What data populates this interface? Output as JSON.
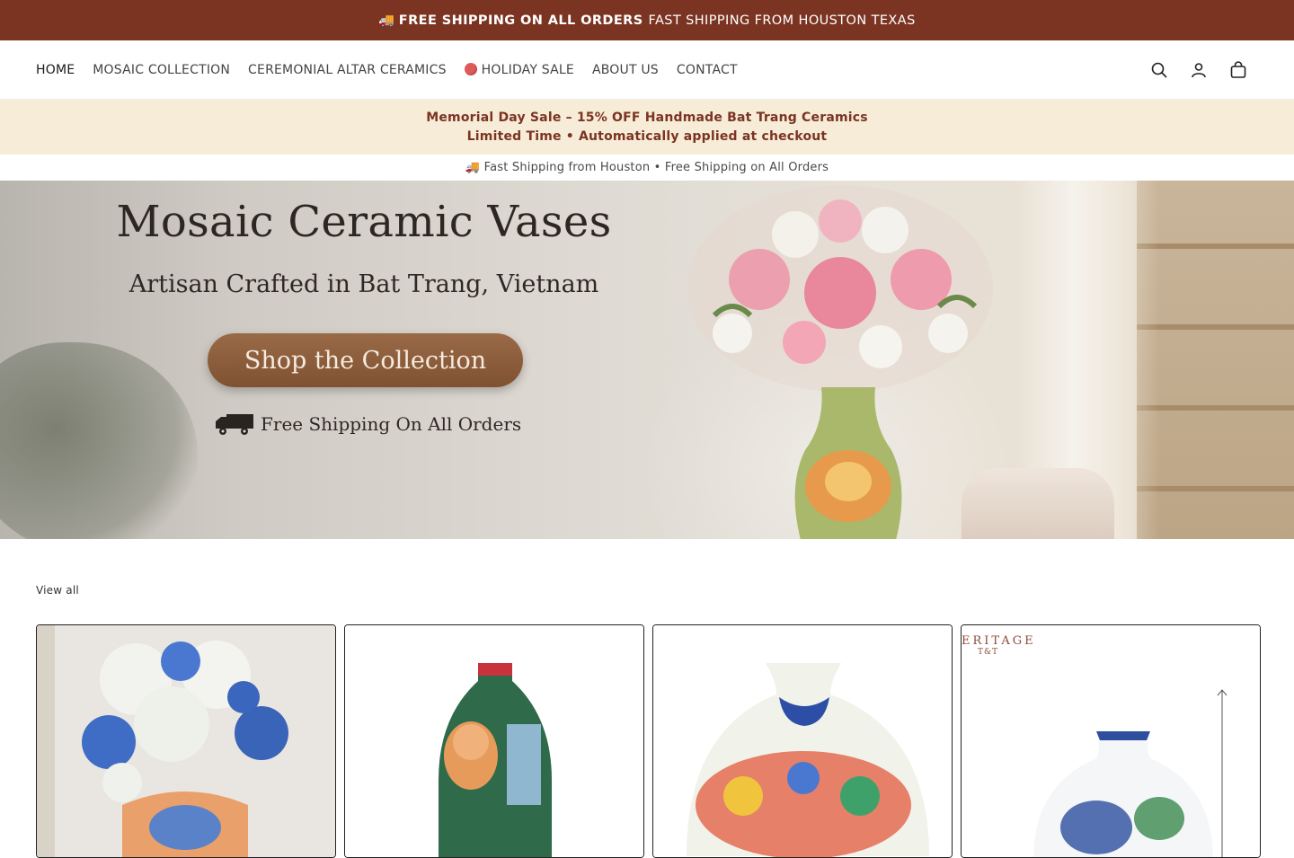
{
  "announcement": {
    "truck": "🚚",
    "bold": "FREE SHIPPING ON ALL ORDERS",
    "text": "FAST SHIPPING FROM HOUSTON TEXAS"
  },
  "nav": {
    "items": [
      {
        "label": "HOME",
        "active": true
      },
      {
        "label": "MOSAIC COLLECTION"
      },
      {
        "label": "CEREMONIAL ALTAR CERAMICS"
      },
      {
        "label": "HOLIDAY SALE",
        "icon": "red-circle-icon"
      },
      {
        "label": "ABOUT US"
      },
      {
        "label": "CONTACT"
      }
    ],
    "icons": [
      "search-icon",
      "account-icon",
      "cart-icon"
    ]
  },
  "sale_banner": {
    "line1": "Memorial Day Sale – 15% OFF Handmade Bat Trang Ceramics",
    "line2": "Limited Time • Automatically applied at checkout"
  },
  "shipping_bar": "🚚 Fast Shipping from Houston • Free Shipping on All Orders",
  "hero": {
    "title": "Mosaic Ceramic Vases",
    "subtitle": "Artisan Crafted in Bat Trang, Vietnam",
    "cta": "Shop the Collection",
    "shipping": "Free Shipping On All Orders"
  },
  "collection": {
    "view_all": "View all",
    "products": [
      {
        "image": "vase-blue-hydrangeas"
      },
      {
        "image": "vase-cat-painted"
      },
      {
        "image": "vase-floral-round"
      },
      {
        "image": "vase-blue-white",
        "brand": "ERITAGE",
        "brand_sub": "T&T"
      }
    ]
  },
  "colors": {
    "announcement_bg": "#7b3422",
    "sale_bg": "#f6ecd7",
    "sale_text": "#7b3422",
    "cta_bg": "#8a5a3a"
  }
}
